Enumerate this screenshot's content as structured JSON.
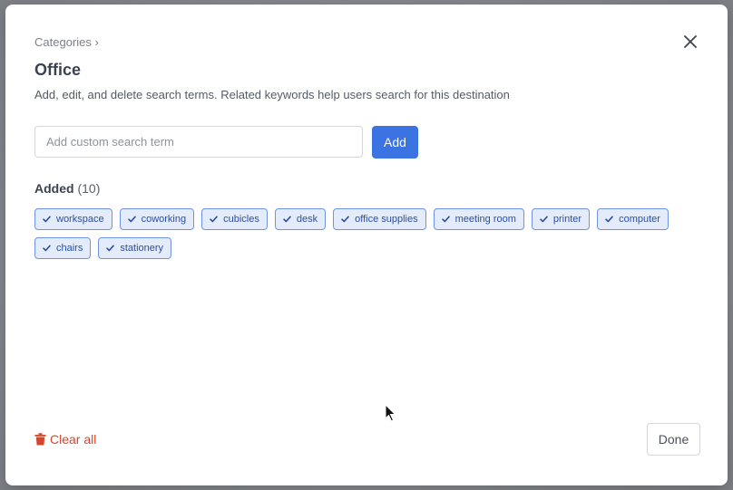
{
  "breadcrumb": {
    "label": "Categories ›"
  },
  "dialog": {
    "title": "Office",
    "subtitle": "Add, edit, and delete search terms. Related keywords help users search for this destination"
  },
  "search": {
    "placeholder": "Add custom search term",
    "value": ""
  },
  "add_button": {
    "label": "Add"
  },
  "added": {
    "heading": "Added",
    "count": "(10)",
    "tags": [
      "workspace",
      "coworking",
      "cubicles",
      "desk",
      "office supplies",
      "meeting room",
      "printer",
      "computer",
      "chairs",
      "stationery"
    ]
  },
  "footer": {
    "clear_all_label": "Clear all",
    "done_label": "Done"
  },
  "icons": {
    "close": "close-icon",
    "check": "check-icon",
    "trash": "trash-icon",
    "cursor": "mouse-cursor-icon"
  },
  "colors": {
    "primary": "#3b73e3",
    "tag_bg": "#e4ecfb",
    "tag_border": "#6f95e2",
    "tag_text": "#2a4f9e",
    "danger": "#d4462b"
  }
}
